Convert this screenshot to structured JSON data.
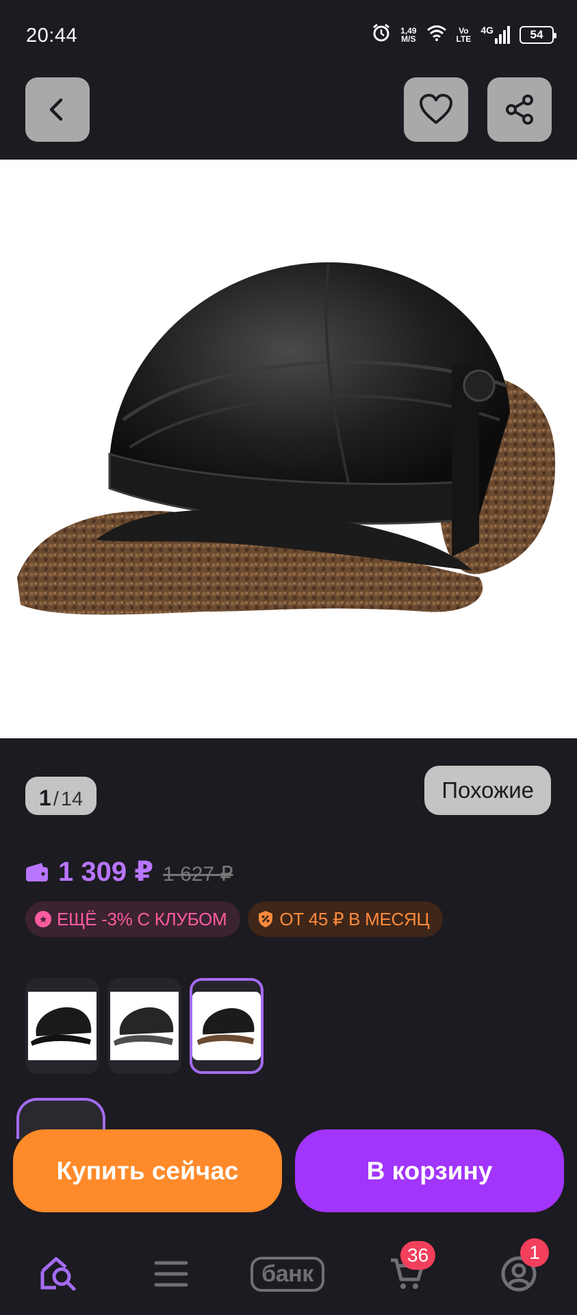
{
  "status_bar": {
    "time": "20:44",
    "net_speed_top": "1,49",
    "net_speed_bottom": "M/S",
    "volte_top": "Vo",
    "volte_bottom": "LTE",
    "network": "4G",
    "battery": "54"
  },
  "topbar": {
    "back_icon": "chevron-left-icon",
    "favorite_icon": "heart-icon",
    "share_icon": "share-icon"
  },
  "product": {
    "image_alt": "black leather cap with brown sherpa ear flaps",
    "counter_current": "1",
    "counter_separator": "/",
    "counter_total": "14",
    "similar_label": "Похожие",
    "price": "1 309 ₽",
    "old_price": "1 627 ₽",
    "badge_club": "ЕЩЁ -3% С КЛУБОМ",
    "badge_month": "ОТ 45 ₽ В МЕСЯЦ"
  },
  "variants": {
    "selected_index": 2,
    "count": 3
  },
  "actions": {
    "buy_now": "Купить сейчас",
    "add_to_cart": "В корзину"
  },
  "bottom_nav": {
    "bank_label": "банк",
    "cart_count": "36",
    "profile_count": "1"
  },
  "colors": {
    "background": "#1c1b21",
    "accent_purple": "#a135fb",
    "price_purple": "#b875ff",
    "buy_orange": "#ff8a2a",
    "badge_red": "#f2405c"
  }
}
